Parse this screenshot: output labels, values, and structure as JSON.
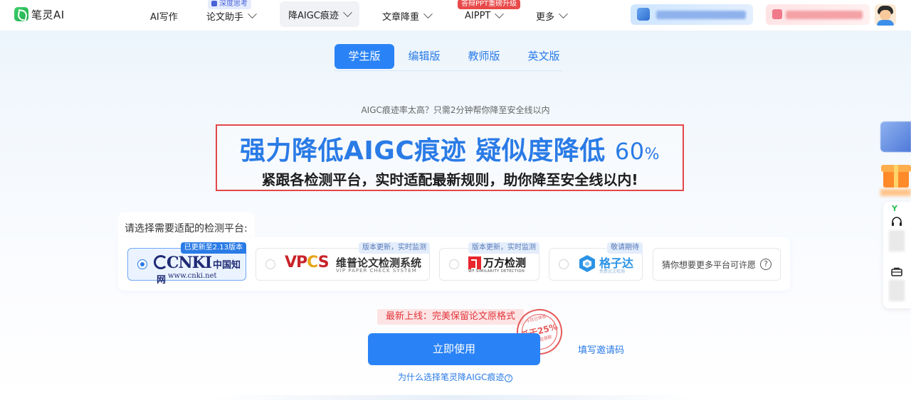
{
  "brand": {
    "name": "笔灵AI",
    "color": "#2a83f6"
  },
  "nav": {
    "items": [
      {
        "label": "AI写作"
      },
      {
        "label": "论文助手",
        "badge": "深度思考"
      },
      {
        "label": "降AIGC痕迹"
      },
      {
        "label": "文章降重"
      },
      {
        "label": "AIPPT",
        "badge": "答辩PPT重磅升级"
      },
      {
        "label": "更多"
      }
    ]
  },
  "tabs": [
    "学生版",
    "编辑版",
    "教师版",
    "英文版"
  ],
  "hero": {
    "subtitle": "AIGC痕迹率太高？只需2分钟帮你降至安全线以内",
    "title": "强力降低AIGC痕迹 疑似度降低",
    "percent_value": "60",
    "percent_sign": "%",
    "description": "紧跟各检测平台，实时适配最新规则，助你降至安全线以内!"
  },
  "platform": {
    "label": "请选择需要适配的检测平台:",
    "options": [
      {
        "tag": "已更新至2.13版本",
        "logo_main": "CNKI",
        "logo_cn": "中国知网",
        "logo_url": "www.cnki.net",
        "selected": true
      },
      {
        "tag": "版本更新，实时监测",
        "logo_main": "VPCS",
        "logo_cn": "维普论文检测系统",
        "logo_en": "VIP PAPER CHECK SYSTEM",
        "selected": false
      },
      {
        "tag": "版本更新，实时监测",
        "logo_cn": "万方检测",
        "logo_en": "WF SIMILARITY DETECTION",
        "selected": false
      },
      {
        "tag": "敬请期待",
        "logo_cn": "格子达",
        "logo_sub": "免费论文检测",
        "selected": false
      }
    ],
    "more_text": "猜你想要更多平台可许愿",
    "help_glyph": "?"
  },
  "cta": {
    "notice": "最新上线：完美保留论文原格式",
    "stamp_top": "今日已体验",
    "stamp_main": "低于25%",
    "stamp_bottom": "不过包退款",
    "button": "立即使用",
    "invite": "填写邀请码",
    "why": "为什么选择笔灵降AIGC痕迹",
    "why_glyph": "?"
  }
}
